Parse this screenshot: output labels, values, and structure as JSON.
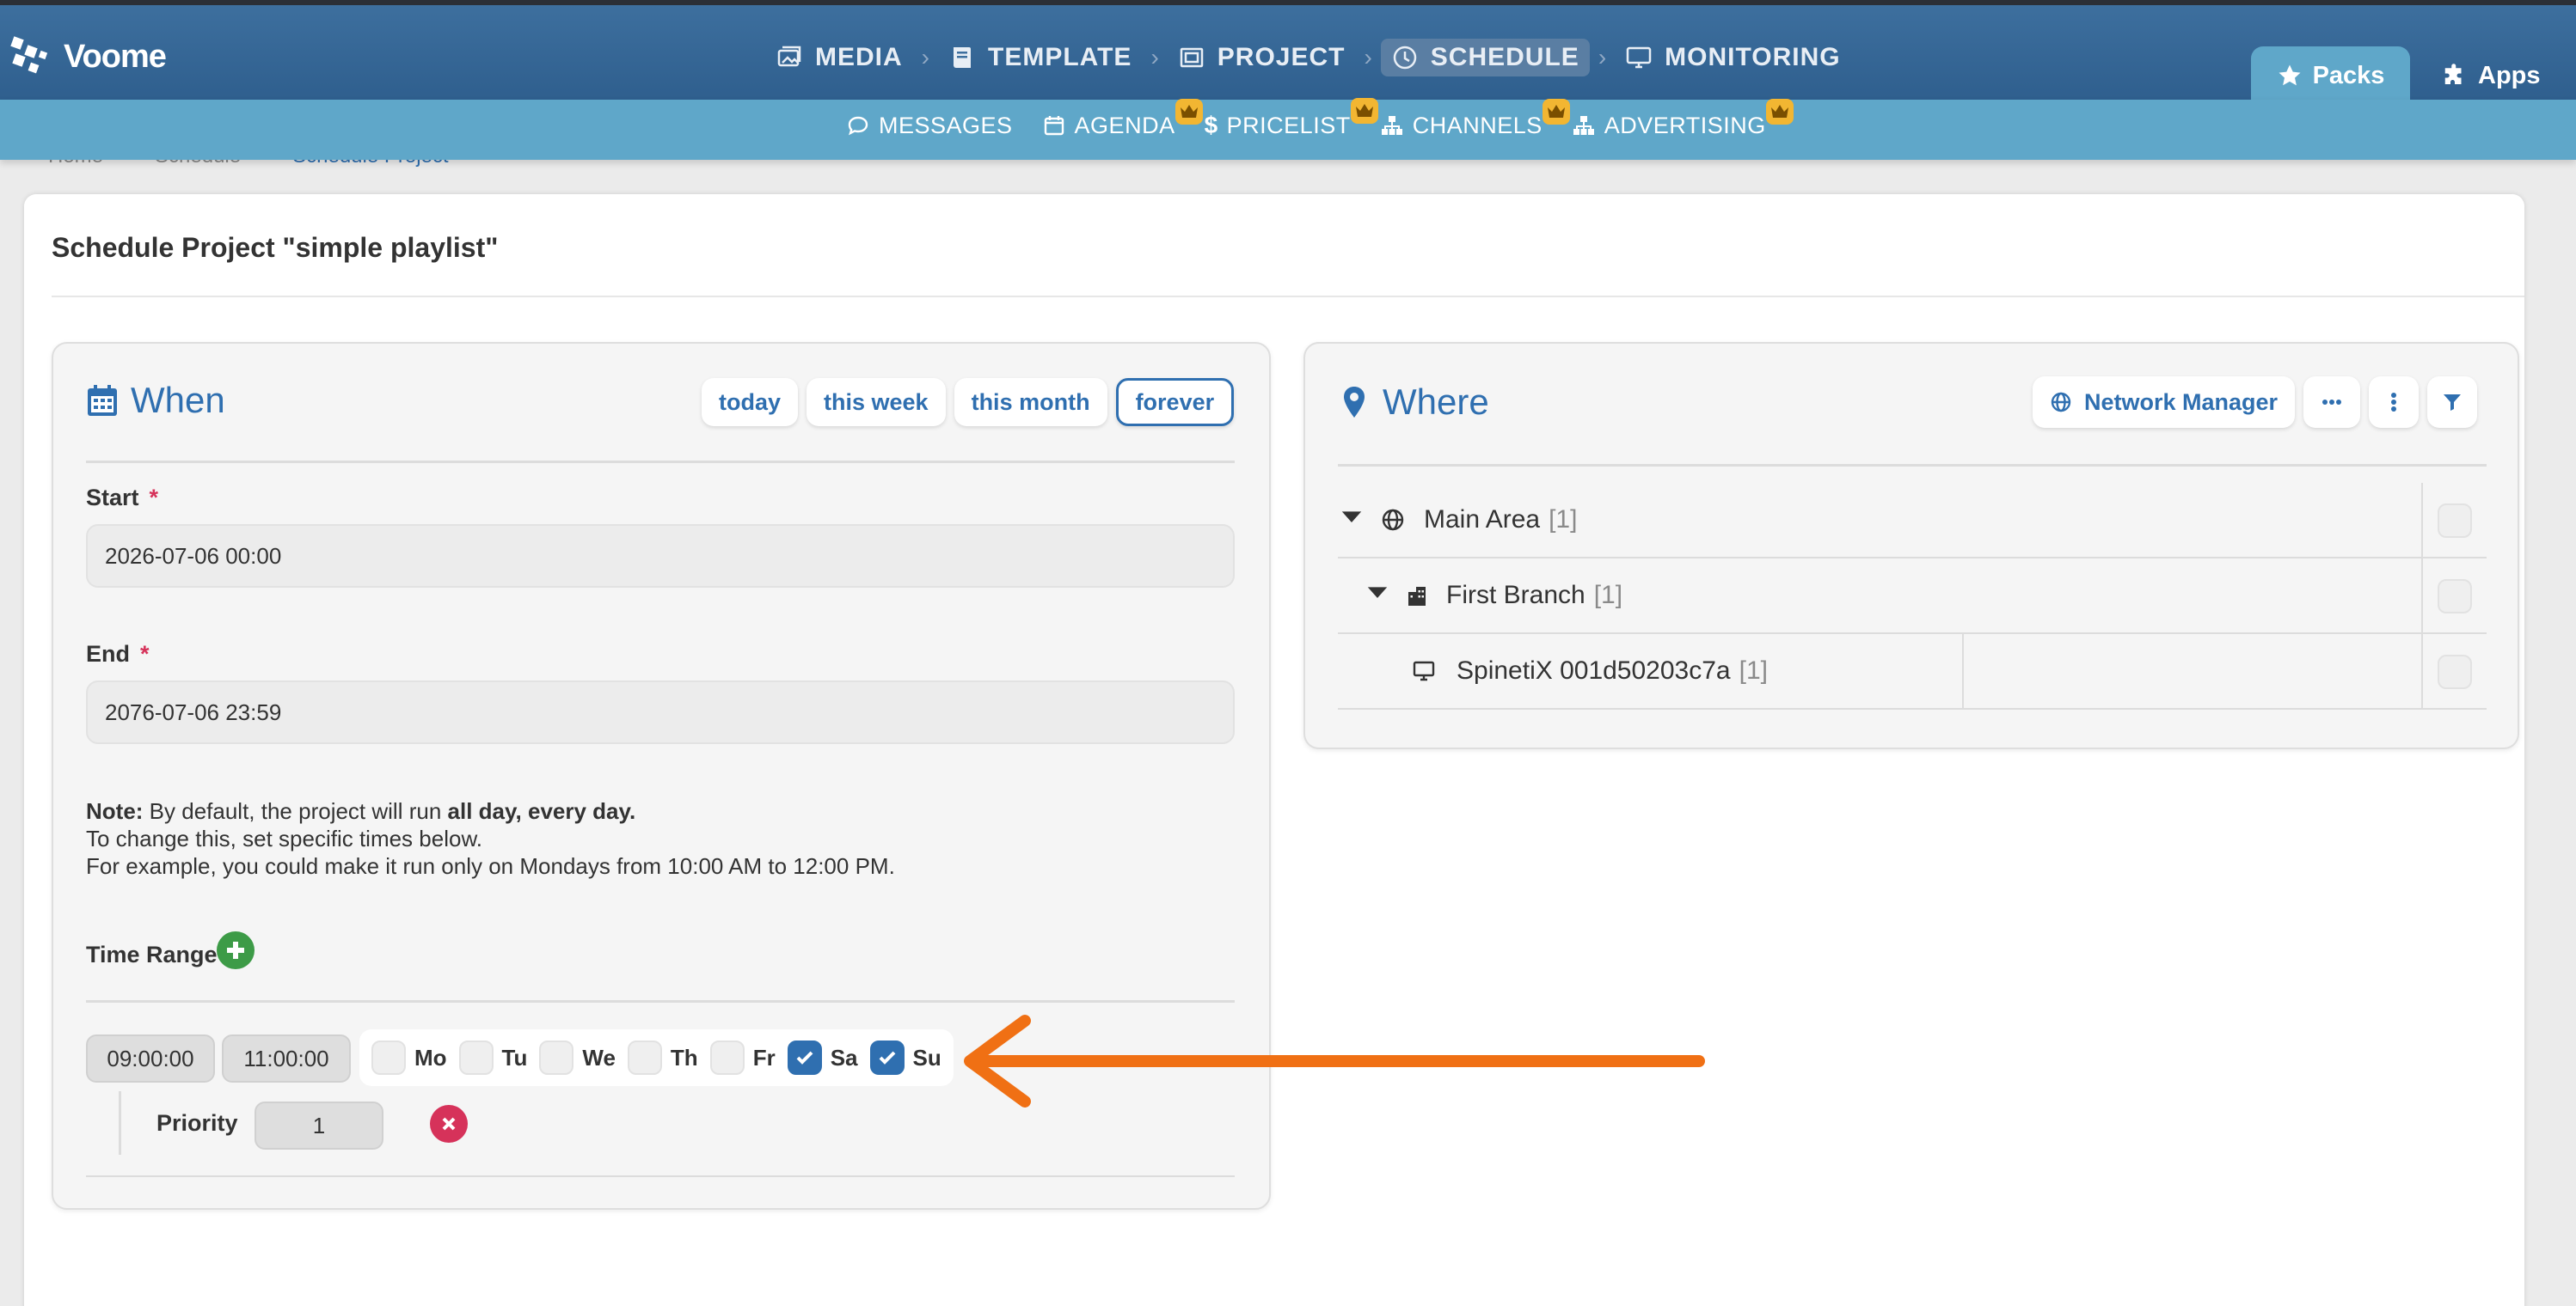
{
  "app": {
    "name": "Voome"
  },
  "main_nav": [
    {
      "label": "MEDIA",
      "icon": "media-icon"
    },
    {
      "label": "TEMPLATE",
      "icon": "book-icon"
    },
    {
      "label": "PROJECT",
      "icon": "project-icon"
    },
    {
      "label": "SCHEDULE",
      "icon": "clock-icon",
      "active": true
    },
    {
      "label": "MONITORING",
      "icon": "monitor-icon"
    }
  ],
  "right_tabs": {
    "packs": "Packs",
    "apps": "Apps"
  },
  "sub_nav": [
    {
      "label": "MESSAGES",
      "icon": "chat-icon",
      "crown": false
    },
    {
      "label": "AGENDA",
      "icon": "calendar-icon",
      "crown": true
    },
    {
      "label": "PRICELIST",
      "icon": "dollar-icon",
      "crown": true
    },
    {
      "label": "CHANNELS",
      "icon": "sitemap-icon",
      "crown": true
    },
    {
      "label": "ADVERTISING",
      "icon": "sitemap-icon",
      "crown": true
    }
  ],
  "breadcrumb": [
    "Home",
    "Schedule",
    "Schedule Project"
  ],
  "page_title": "Schedule Project \"simple playlist\"",
  "when": {
    "title": "When",
    "ranges": [
      "today",
      "this week",
      "this month",
      "forever"
    ],
    "selected_range": "forever",
    "start_label": "Start",
    "start_value": "2026-07-06 00:00",
    "end_label": "End",
    "end_value": "2076-07-06 23:59",
    "note_prefix": "Note:",
    "note_text1": "By default, the project will run",
    "note_bold": "all day, every day.",
    "note_line2": "To change this, set specific times below.",
    "note_line3": "For example, you could make it run only on Mondays from 10:00 AM to 12:00 PM.",
    "time_range_label": "Time Range",
    "time_from": "09:00:00",
    "time_to": "11:00:00",
    "days": [
      {
        "label": "Mo",
        "checked": false
      },
      {
        "label": "Tu",
        "checked": false
      },
      {
        "label": "We",
        "checked": false
      },
      {
        "label": "Th",
        "checked": false
      },
      {
        "label": "Fr",
        "checked": false
      },
      {
        "label": "Sa",
        "checked": true
      },
      {
        "label": "Su",
        "checked": true
      }
    ],
    "priority_label": "Priority",
    "priority_value": "1"
  },
  "where": {
    "title": "Where",
    "network_manager_label": "Network Manager",
    "tree": [
      {
        "label": "Main Area",
        "count": "[1]",
        "icon": "globe-icon",
        "expanded": true,
        "level": 0
      },
      {
        "label": "First Branch",
        "count": "[1]",
        "icon": "building-icon",
        "expanded": true,
        "level": 1
      },
      {
        "label": "SpinetiX 001d50203c7a",
        "count": "[1]",
        "icon": "monitor-icon",
        "level": 2
      }
    ]
  },
  "colors": {
    "brand": "#2f6fb0",
    "topbar": "#3d6f9e",
    "subbar": "#5fa7c9",
    "accent_arrow": "#f07014",
    "danger": "#d6325a",
    "success": "#3d9b47",
    "crown": "#f2b632"
  }
}
